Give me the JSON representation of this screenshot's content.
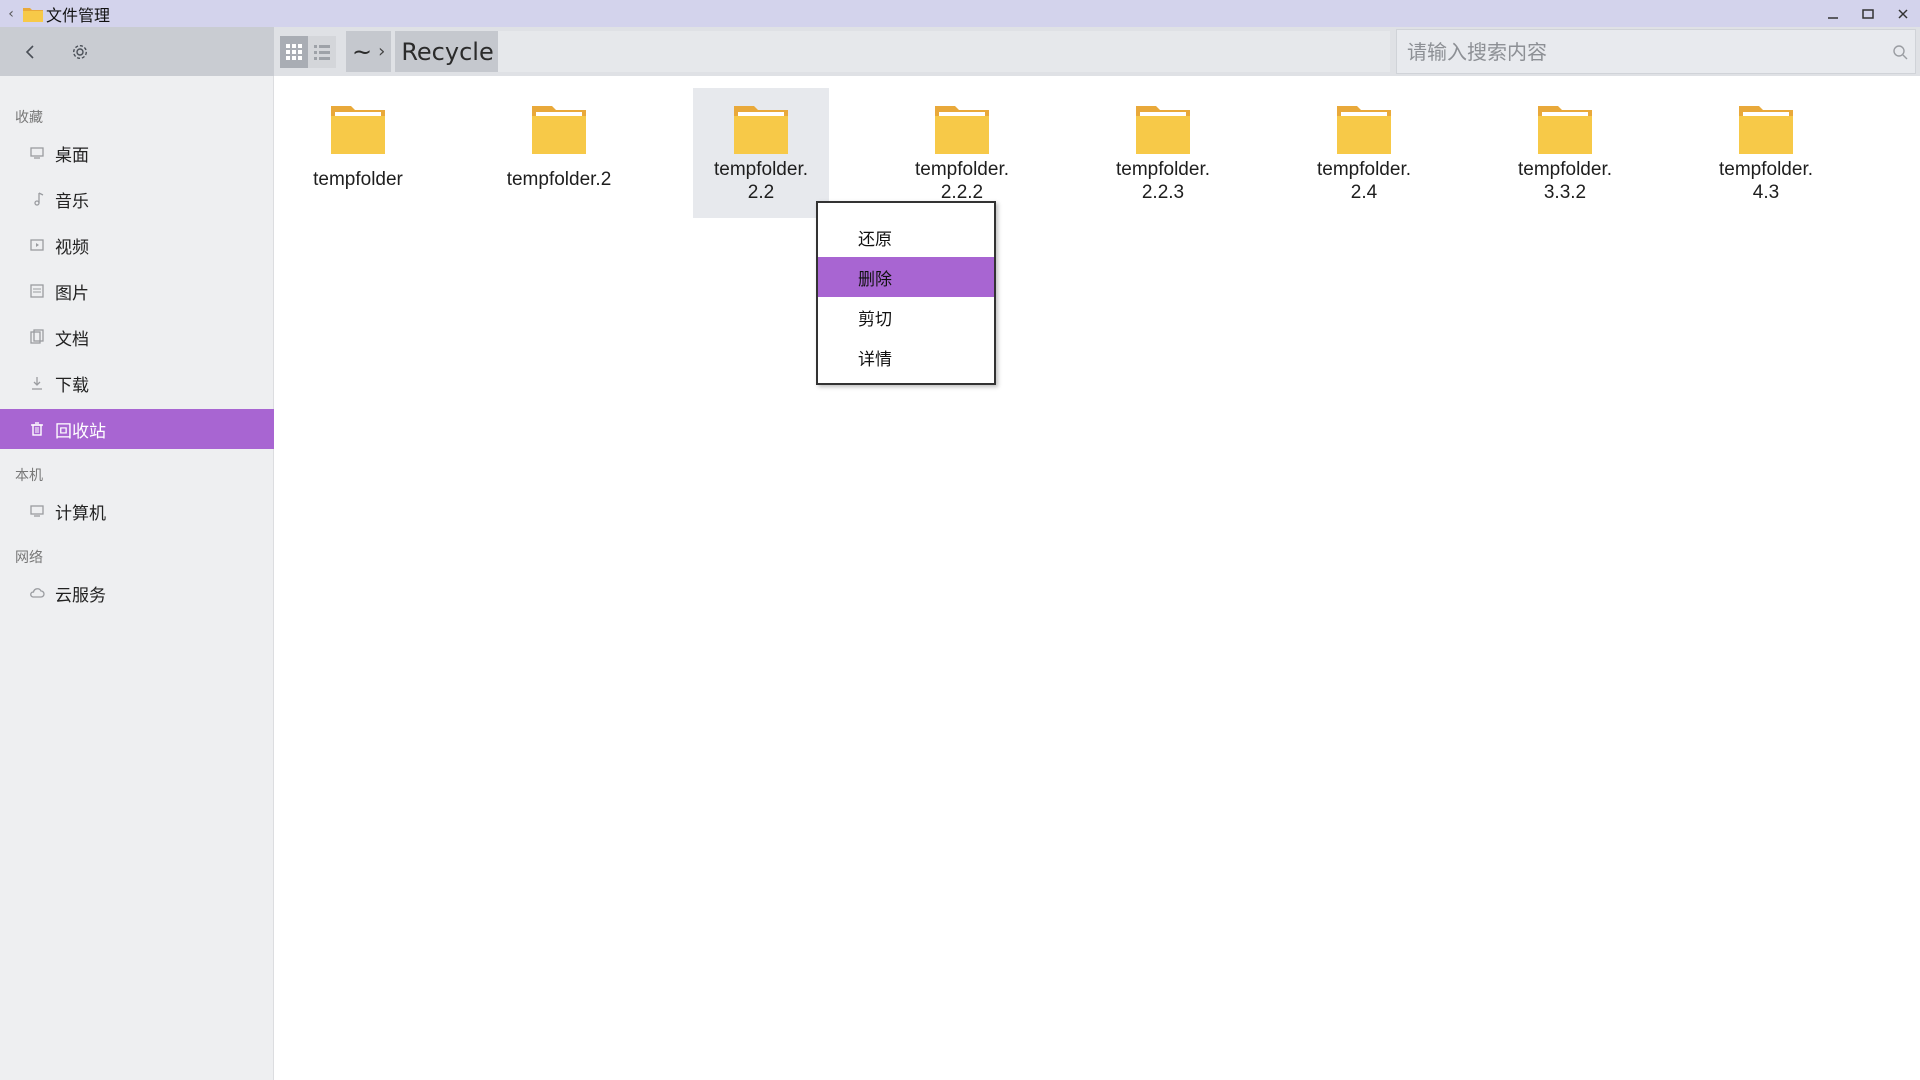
{
  "window": {
    "title": "文件管理",
    "back_glyph": "‹"
  },
  "toolbar": {
    "breadcrumb": [
      {
        "label": "~"
      },
      {
        "label": "Recycle"
      }
    ],
    "crumb_separator": "›",
    "search_placeholder": "请输入搜索内容"
  },
  "sidebar": {
    "sections": {
      "favorites": "收藏",
      "local": "本机",
      "network": "网络"
    },
    "favorites": [
      {
        "label": "桌面",
        "icon": "monitor-icon"
      },
      {
        "label": "音乐",
        "icon": "music-icon"
      },
      {
        "label": "视频",
        "icon": "video-icon"
      },
      {
        "label": "图片",
        "icon": "image-icon"
      },
      {
        "label": "文档",
        "icon": "document-icon"
      },
      {
        "label": "下载",
        "icon": "download-icon"
      },
      {
        "label": "回收站",
        "icon": "trash-icon",
        "active": true
      }
    ],
    "local": [
      {
        "label": "计算机",
        "icon": "computer-icon"
      }
    ],
    "network": [
      {
        "label": "云服务",
        "icon": "cloud-icon"
      }
    ]
  },
  "files": [
    {
      "name": "tempfolder"
    },
    {
      "name": "tempfolder.2"
    },
    {
      "name": "tempfolder.\n2.2",
      "selected": true
    },
    {
      "name": "tempfolder.\n2.2.2"
    },
    {
      "name": "tempfolder.\n2.2.3"
    },
    {
      "name": "tempfolder.\n2.4"
    },
    {
      "name": "tempfolder.\n3.3.2"
    },
    {
      "name": "tempfolder.\n4.3"
    }
  ],
  "context_menu": {
    "items": [
      {
        "label": "还原"
      },
      {
        "label": "删除",
        "active": true
      },
      {
        "label": "剪切"
      },
      {
        "label": "详情"
      }
    ]
  },
  "colors": {
    "accent": "#a865d2",
    "folder": "#f7c948",
    "folder_dark": "#e9a93a"
  }
}
